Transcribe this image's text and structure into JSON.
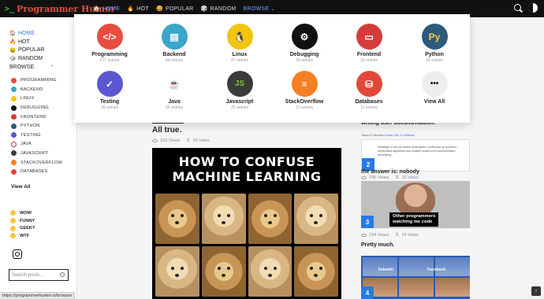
{
  "header": {
    "logo_prompt": ">_",
    "logo_text": "Programmer Humor",
    "nav": [
      {
        "label": "HOME",
        "icon": "home-icon",
        "glyph": "🏠"
      },
      {
        "label": "HOT",
        "icon": "fire-icon",
        "glyph": "🔥"
      },
      {
        "label": "POPULAR",
        "icon": "smile-icon",
        "glyph": "😀"
      },
      {
        "label": "RANDOM",
        "icon": "cube-icon",
        "glyph": "🎲"
      },
      {
        "label": "BROWSE",
        "icon": "",
        "glyph": ""
      }
    ]
  },
  "sidebar": {
    "main": [
      "HOME",
      "HOT",
      "POPULAR",
      "RANDOM",
      "BROWSE"
    ],
    "categories": [
      "PROGRAMMING",
      "BACKEND",
      "LINUX",
      "DEBUGGING",
      "FRONTEND",
      "PYTHON",
      "TESTING",
      "JAVA",
      "JAVASCRIPT",
      "STACKOVERFLOW",
      "DATABASES"
    ],
    "view_all": "View All",
    "reactions": [
      "WOW",
      "FUNNY",
      "GEEKY",
      "WTF"
    ],
    "search_placeholder": "Search posts..."
  },
  "browse_menu": [
    {
      "label": "Programming",
      "count": "277 entries",
      "color": "#e74c3c",
      "glyph": "</>"
    },
    {
      "label": "Backend",
      "count": "84 entries",
      "color": "#3aa6c9",
      "glyph": "▤"
    },
    {
      "label": "Linux",
      "count": "47 entries",
      "color": "#f1c40f",
      "glyph": "🐧"
    },
    {
      "label": "Debugging",
      "count": "29 entries",
      "color": "#111111",
      "glyph": "⚙"
    },
    {
      "label": "Frontend",
      "count": "33 entries",
      "color": "#d63b3b",
      "glyph": "▭"
    },
    {
      "label": "Python",
      "count": "30 entries",
      "color": "#2c5a7a",
      "glyph": "Py"
    },
    {
      "label": "Testing",
      "count": "28 entries",
      "color": "#5b57d1",
      "glyph": "✓"
    },
    {
      "label": "Java",
      "count": "25 entries",
      "color": "#ffffff",
      "glyph": "☕"
    },
    {
      "label": "Javascript",
      "count": "22 entries",
      "color": "#3b3b3b",
      "glyph": "JS"
    },
    {
      "label": "StackOverflow",
      "count": "21 entries",
      "color": "#f48024",
      "glyph": "≡"
    },
    {
      "label": "Databases",
      "count": "11 entries",
      "color": "#e0493a",
      "glyph": "⛁"
    },
    {
      "label": "View All",
      "count": "",
      "color": "#eeeeee",
      "glyph": "•••"
    }
  ],
  "main_post": {
    "title": "All true.",
    "views": "103 Views",
    "votes": "16 Votes",
    "meme_line1": "HOW TO CONFUSE",
    "meme_line2": "MACHINE LEARNING"
  },
  "right_column": {
    "post1_title": "writing user documentation:",
    "post1_author": "Jason D Moeller",
    "post1_links": "Adam Lilly & Williams",
    "post1_text": "Paradigm of the job market marketplace conference on quantum-accelerated algorithms and multiple modes from documentation processing...",
    "post1_badge": "2",
    "post1_views": "140 Views",
    "post1_votes": "16 Votes",
    "post2_title": "the answer is: nobody",
    "post2_caption_l1": "Other programmers",
    "post2_caption_l2": "watching me code",
    "post2_badge": "3",
    "post2_views": "134 Views",
    "post2_votes": "19 Votes",
    "post3_title": "Pretty much.",
    "post3_label1": "linkedin",
    "post3_label2": "Facebook",
    "post3_badge": "4"
  },
  "status_url": "https://programmerhumor.io/browse/",
  "scroll_top": "↑"
}
